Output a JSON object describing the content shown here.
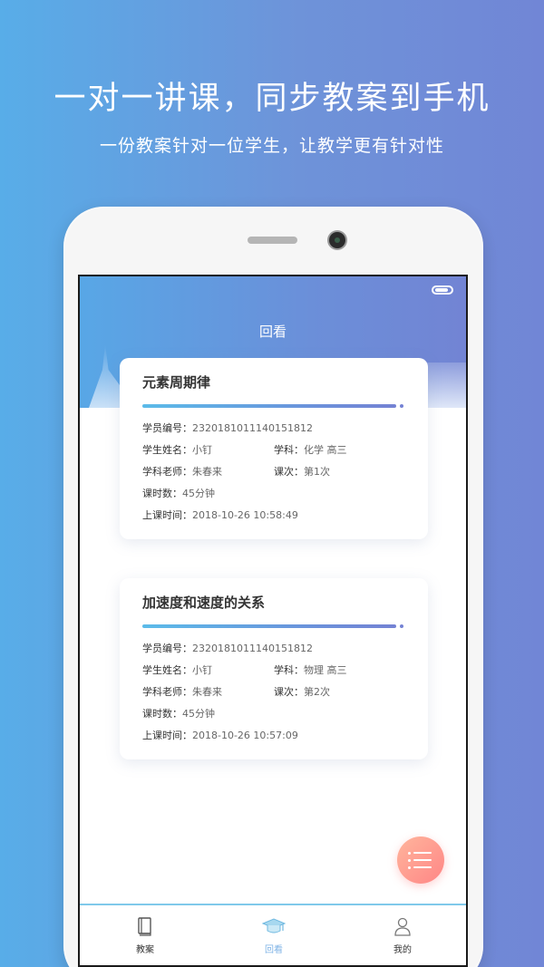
{
  "promo": {
    "headline": "一对一讲课，同步教案到手机",
    "subline": "一份教案针对一位学生，让教学更有针对性"
  },
  "app": {
    "title": "回看",
    "colors": {
      "header_start": "#58a7e6",
      "header_end": "#7284d4",
      "fab_start": "#ffb59c",
      "fab_end": "#ff8686",
      "active_tab": "#7fb3e6"
    }
  },
  "labels": {
    "student_no": "学员编号：",
    "student_name": "学生姓名：",
    "subject": "学科：",
    "teacher": "学科老师：",
    "lesson": "课次：",
    "duration": "课时数：",
    "time": "上课时间："
  },
  "lessons": [
    {
      "title": "元素周期律",
      "student_no": "2320181011140151812",
      "student_name": "小钉",
      "subject": "化学 高三",
      "teacher": "朱春来",
      "lesson": "第1次",
      "duration": "45分钟",
      "time": "2018-10-26 10:58:49"
    },
    {
      "title": "加速度和速度的关系",
      "student_no": "2320181011140151812",
      "student_name": "小钉",
      "subject": "物理 高三",
      "teacher": "朱春来",
      "lesson": "第2次",
      "duration": "45分钟",
      "time": "2018-10-26 10:57:09"
    }
  ],
  "tabs": [
    {
      "label": "教案",
      "icon": "book-icon"
    },
    {
      "label": "回看",
      "icon": "graduation-cap-icon"
    },
    {
      "label": "我的",
      "icon": "user-icon"
    }
  ]
}
